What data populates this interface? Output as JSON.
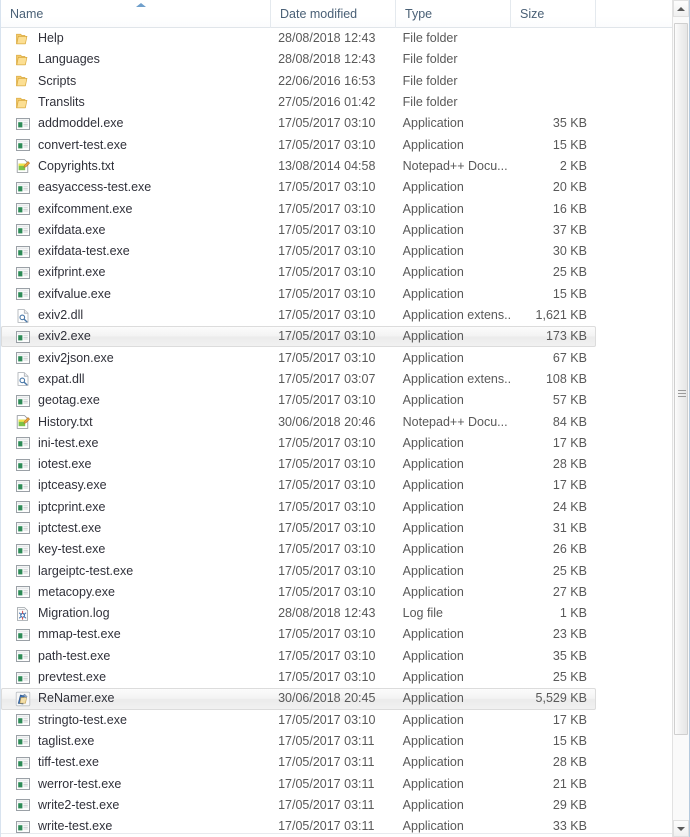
{
  "window": {
    "title": "File list",
    "accent_color": "#4a6076",
    "selection_color": "#ebebeb",
    "text_color": "#30313a"
  },
  "columns": {
    "name": "Name",
    "date_modified": "Date modified",
    "type": "Type",
    "size": "Size",
    "blank": "",
    "sort_icon": "sort-ascending-icon",
    "sorted_by": "Name",
    "sort_direction": "ascending"
  },
  "scrollbar": {
    "up_icon": "scroll-up-arrow-icon",
    "down_icon": "scroll-down-arrow-icon",
    "grip_icon": "scrollbar-grip-icon"
  },
  "rows": [
    {
      "name": "Help",
      "date": "28/08/2018 12:43",
      "type": "File folder",
      "size": "",
      "icon": "folder-icon",
      "selected": false
    },
    {
      "name": "Languages",
      "date": "28/08/2018 12:43",
      "type": "File folder",
      "size": "",
      "icon": "folder-icon",
      "selected": false
    },
    {
      "name": "Scripts",
      "date": "22/06/2016 16:53",
      "type": "File folder",
      "size": "",
      "icon": "folder-icon",
      "selected": false
    },
    {
      "name": "Translits",
      "date": "27/05/2016 01:42",
      "type": "File folder",
      "size": "",
      "icon": "folder-icon",
      "selected": false
    },
    {
      "name": "addmoddel.exe",
      "date": "17/05/2017 03:10",
      "type": "Application",
      "size": "35 KB",
      "icon": "application-icon",
      "selected": false
    },
    {
      "name": "convert-test.exe",
      "date": "17/05/2017 03:10",
      "type": "Application",
      "size": "15 KB",
      "icon": "application-icon",
      "selected": false
    },
    {
      "name": "Copyrights.txt",
      "date": "13/08/2014 04:58",
      "type": "Notepad++ Docu...",
      "size": "2 KB",
      "icon": "notepadpp-document-icon",
      "selected": false
    },
    {
      "name": "easyaccess-test.exe",
      "date": "17/05/2017 03:10",
      "type": "Application",
      "size": "20 KB",
      "icon": "application-icon",
      "selected": false
    },
    {
      "name": "exifcomment.exe",
      "date": "17/05/2017 03:10",
      "type": "Application",
      "size": "16 KB",
      "icon": "application-icon",
      "selected": false
    },
    {
      "name": "exifdata.exe",
      "date": "17/05/2017 03:10",
      "type": "Application",
      "size": "37 KB",
      "icon": "application-icon",
      "selected": false
    },
    {
      "name": "exifdata-test.exe",
      "date": "17/05/2017 03:10",
      "type": "Application",
      "size": "30 KB",
      "icon": "application-icon",
      "selected": false
    },
    {
      "name": "exifprint.exe",
      "date": "17/05/2017 03:10",
      "type": "Application",
      "size": "25 KB",
      "icon": "application-icon",
      "selected": false
    },
    {
      "name": "exifvalue.exe",
      "date": "17/05/2017 03:10",
      "type": "Application",
      "size": "15 KB",
      "icon": "application-icon",
      "selected": false
    },
    {
      "name": "exiv2.dll",
      "date": "17/05/2017 03:10",
      "type": "Application extens...",
      "size": "1,621 KB",
      "icon": "dll-icon",
      "selected": false
    },
    {
      "name": "exiv2.exe",
      "date": "17/05/2017 03:10",
      "type": "Application",
      "size": "173 KB",
      "icon": "application-icon",
      "selected": true
    },
    {
      "name": "exiv2json.exe",
      "date": "17/05/2017 03:10",
      "type": "Application",
      "size": "67 KB",
      "icon": "application-icon",
      "selected": false
    },
    {
      "name": "expat.dll",
      "date": "17/05/2017 03:07",
      "type": "Application extens...",
      "size": "108 KB",
      "icon": "dll-icon",
      "selected": false
    },
    {
      "name": "geotag.exe",
      "date": "17/05/2017 03:10",
      "type": "Application",
      "size": "57 KB",
      "icon": "application-icon",
      "selected": false
    },
    {
      "name": "History.txt",
      "date": "30/06/2018 20:46",
      "type": "Notepad++ Docu...",
      "size": "84 KB",
      "icon": "notepadpp-document-icon",
      "selected": false
    },
    {
      "name": "ini-test.exe",
      "date": "17/05/2017 03:10",
      "type": "Application",
      "size": "17 KB",
      "icon": "application-icon",
      "selected": false
    },
    {
      "name": "iotest.exe",
      "date": "17/05/2017 03:10",
      "type": "Application",
      "size": "28 KB",
      "icon": "application-icon",
      "selected": false
    },
    {
      "name": "iptceasy.exe",
      "date": "17/05/2017 03:10",
      "type": "Application",
      "size": "17 KB",
      "icon": "application-icon",
      "selected": false
    },
    {
      "name": "iptcprint.exe",
      "date": "17/05/2017 03:10",
      "type": "Application",
      "size": "24 KB",
      "icon": "application-icon",
      "selected": false
    },
    {
      "name": "iptctest.exe",
      "date": "17/05/2017 03:10",
      "type": "Application",
      "size": "31 KB",
      "icon": "application-icon",
      "selected": false
    },
    {
      "name": "key-test.exe",
      "date": "17/05/2017 03:10",
      "type": "Application",
      "size": "26 KB",
      "icon": "application-icon",
      "selected": false
    },
    {
      "name": "largeiptc-test.exe",
      "date": "17/05/2017 03:10",
      "type": "Application",
      "size": "25 KB",
      "icon": "application-icon",
      "selected": false
    },
    {
      "name": "metacopy.exe",
      "date": "17/05/2017 03:10",
      "type": "Application",
      "size": "27 KB",
      "icon": "application-icon",
      "selected": false
    },
    {
      "name": "Migration.log",
      "date": "28/08/2018 12:43",
      "type": "Log file",
      "size": "1 KB",
      "icon": "log-file-icon",
      "selected": false
    },
    {
      "name": "mmap-test.exe",
      "date": "17/05/2017 03:10",
      "type": "Application",
      "size": "23 KB",
      "icon": "application-icon",
      "selected": false
    },
    {
      "name": "path-test.exe",
      "date": "17/05/2017 03:10",
      "type": "Application",
      "size": "35 KB",
      "icon": "application-icon",
      "selected": false
    },
    {
      "name": "prevtest.exe",
      "date": "17/05/2017 03:10",
      "type": "Application",
      "size": "25 KB",
      "icon": "application-icon",
      "selected": false
    },
    {
      "name": "ReNamer.exe",
      "date": "30/06/2018 20:45",
      "type": "Application",
      "size": "5,529 KB",
      "icon": "renamer-app-icon",
      "selected": true
    },
    {
      "name": "stringto-test.exe",
      "date": "17/05/2017 03:10",
      "type": "Application",
      "size": "17 KB",
      "icon": "application-icon",
      "selected": false
    },
    {
      "name": "taglist.exe",
      "date": "17/05/2017 03:11",
      "type": "Application",
      "size": "15 KB",
      "icon": "application-icon",
      "selected": false
    },
    {
      "name": "tiff-test.exe",
      "date": "17/05/2017 03:11",
      "type": "Application",
      "size": "28 KB",
      "icon": "application-icon",
      "selected": false
    },
    {
      "name": "werror-test.exe",
      "date": "17/05/2017 03:11",
      "type": "Application",
      "size": "21 KB",
      "icon": "application-icon",
      "selected": false
    },
    {
      "name": "write2-test.exe",
      "date": "17/05/2017 03:11",
      "type": "Application",
      "size": "29 KB",
      "icon": "application-icon",
      "selected": false
    },
    {
      "name": "write-test.exe",
      "date": "17/05/2017 03:11",
      "type": "Application",
      "size": "33 KB",
      "icon": "application-icon",
      "selected": false
    }
  ]
}
